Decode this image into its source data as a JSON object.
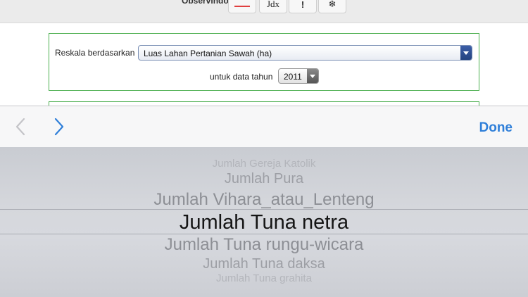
{
  "toolbar_top": {
    "label": "Observindo:",
    "buttons": [
      {
        "icon": "red-line-icon",
        "text": ""
      },
      {
        "icon": "jdx-icon",
        "text": "Jdx"
      },
      {
        "icon": "info-icon",
        "text": "!"
      },
      {
        "icon": "snowflake-icon",
        "text": "❄"
      }
    ]
  },
  "form": {
    "rescale_label": "Reskala berdasarkan",
    "rescale_value": "Luas Lahan Pertanian Sawah (ha)",
    "year_label": "untuk data tahun",
    "year_value": "2011"
  },
  "accessory": {
    "prev_icon": "chevron-left-icon",
    "next_icon": "chevron-right-icon",
    "done_label": "Done",
    "accent": "#2f7fd9"
  },
  "picker": {
    "items": [
      "Jumlah Gereja Katolik",
      "Jumlah Pura",
      "Jumlah Vihara_atau_Lenteng",
      "Jumlah Tuna netra",
      "Jumlah Tuna rungu-wicara",
      "Jumlah Tuna daksa",
      "Jumlah Tuna grahita"
    ],
    "selected": "Jumlah Tuna netra"
  }
}
